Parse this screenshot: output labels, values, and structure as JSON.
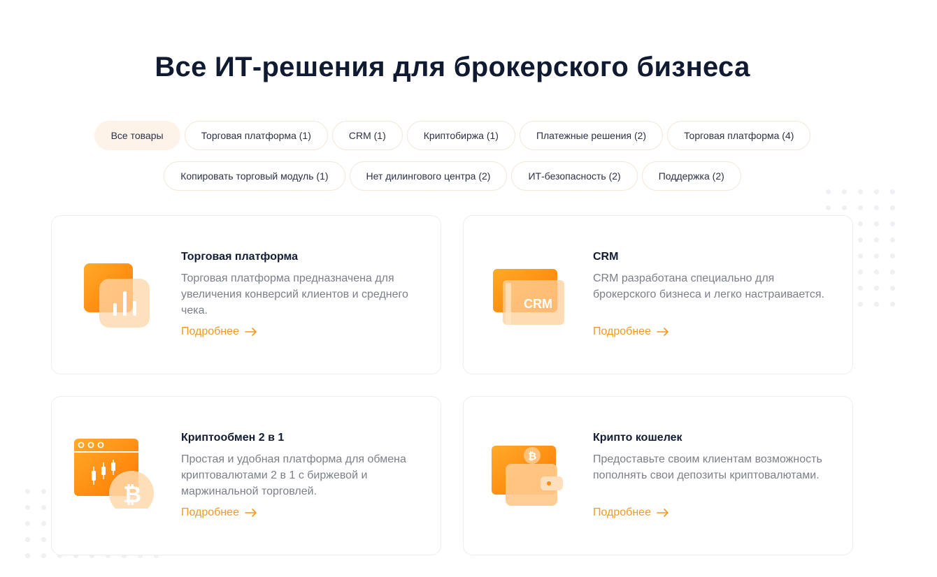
{
  "page": {
    "title": "Все ИТ-решения для брокерского бизнеса"
  },
  "filters": {
    "row1": [
      "Все товары",
      "Торговая платформа (1)",
      "CRM (1)",
      "Криптобиржа (1)",
      "Платежные решения (2)",
      "Торговая платформа (4)"
    ],
    "row2": [
      "Копировать торговый модуль (1)",
      "Нет дилингового центра (2)",
      "ИТ-безопасность (2)",
      "Поддержка (2)"
    ],
    "active": "Все товары"
  },
  "cards": [
    {
      "title": "Торговая платформа",
      "description": "Торговая платформа предназначена для увеличения конверсий клиентов и среднего чека.",
      "link": "Подробнее",
      "icon": "chart-bars-icon"
    },
    {
      "title": "CRM",
      "description": "CRM разработана специально для брокерского бизнеса и легко настраивается.",
      "link": "Подробнее",
      "icon": "crm-icon",
      "icon_text": "CRM"
    },
    {
      "title": "Криптообмен 2 в 1",
      "description": "Простая и удобная платформа для обмена криптовалютами 2 в 1 с биржевой и маржинальной торговлей.",
      "link": "Подробнее",
      "icon": "crypto-exchange-icon"
    },
    {
      "title": "Крипто кошелек",
      "description": "Предоставьте своим клиентам возможность пополнять свои депозиты криптовалютами.",
      "link": "Подробнее",
      "icon": "crypto-wallet-icon"
    }
  ],
  "colors": {
    "accent": "#f29a1f",
    "chip_active_bg": "#fdf3e9",
    "title": "#101a31",
    "text_muted": "#7b7f88"
  }
}
